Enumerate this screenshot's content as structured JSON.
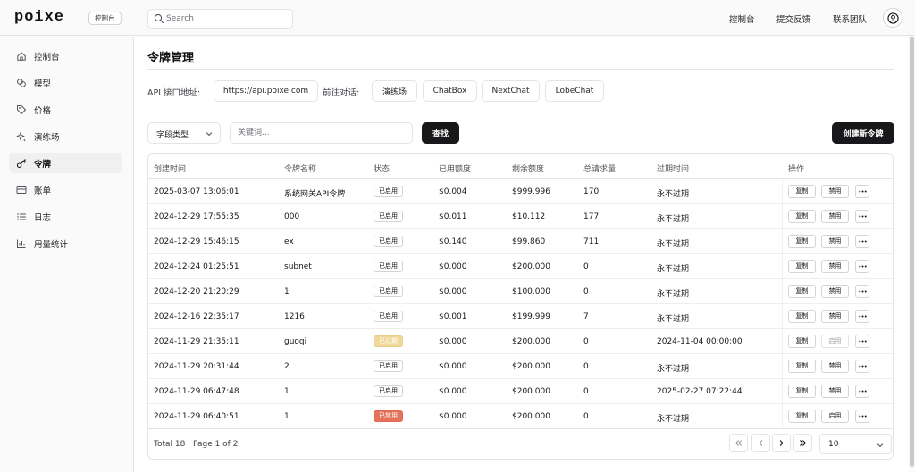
{
  "topbar": {
    "logo": "poixe",
    "console_badge": "控制台",
    "search_placeholder": "Search",
    "links": [
      "控制台",
      "提交反馈",
      "联系团队"
    ]
  },
  "sidebar": {
    "items": [
      {
        "label": "控制台",
        "icon": "home-icon",
        "active": false
      },
      {
        "label": "模型",
        "icon": "models-icon",
        "active": false
      },
      {
        "label": "价格",
        "icon": "tag-icon",
        "active": false
      },
      {
        "label": "演练场",
        "icon": "sparkle-icon",
        "active": false
      },
      {
        "label": "令牌",
        "icon": "key-icon",
        "active": true
      },
      {
        "label": "账单",
        "icon": "credit-card-icon",
        "active": false
      },
      {
        "label": "日志",
        "icon": "list-icon",
        "active": false
      },
      {
        "label": "用量统计",
        "icon": "bar-chart-icon",
        "active": false
      }
    ]
  },
  "main": {
    "title": "令牌管理",
    "api_label": "API 接口地址:",
    "api_url": "https://api.poixe.com",
    "goto_label": "前往对话:",
    "goto_buttons": [
      "演练场",
      "ChatBox",
      "NextChat",
      "LobeChat"
    ],
    "filter": {
      "type_select": "字段类型",
      "keyword_placeholder": "关键词...",
      "search_button": "查找",
      "create_button": "创建新令牌"
    }
  },
  "table": {
    "columns": [
      "创建时间",
      "令牌名称",
      "状态",
      "已用额度",
      "剩余额度",
      "总请求量",
      "过期时间",
      "操作"
    ],
    "rows": [
      {
        "created": "2025-03-07 13:06:01",
        "name": "系统网关API令牌",
        "status": "已启用",
        "status_type": "enabled",
        "used": "$0.004",
        "remaining": "$999.996",
        "requests": "170",
        "expires": "永不过期",
        "action_copy": "复制",
        "action_toggle": "禁用",
        "toggle_muted": false
      },
      {
        "created": "2024-12-29 17:55:35",
        "name": "000",
        "status": "已启用",
        "status_type": "enabled",
        "used": "$0.011",
        "remaining": "$10.112",
        "requests": "177",
        "expires": "永不过期",
        "action_copy": "复制",
        "action_toggle": "禁用",
        "toggle_muted": false
      },
      {
        "created": "2024-12-29 15:46:15",
        "name": "ex",
        "status": "已启用",
        "status_type": "enabled",
        "used": "$0.140",
        "remaining": "$99.860",
        "requests": "711",
        "expires": "永不过期",
        "action_copy": "复制",
        "action_toggle": "禁用",
        "toggle_muted": false
      },
      {
        "created": "2024-12-24 01:25:51",
        "name": "subnet",
        "status": "已启用",
        "status_type": "enabled",
        "used": "$0.000",
        "remaining": "$200.000",
        "requests": "0",
        "expires": "永不过期",
        "action_copy": "复制",
        "action_toggle": "禁用",
        "toggle_muted": false
      },
      {
        "created": "2024-12-20 21:20:29",
        "name": "1",
        "status": "已启用",
        "status_type": "enabled",
        "used": "$0.000",
        "remaining": "$100.000",
        "requests": "0",
        "expires": "永不过期",
        "action_copy": "复制",
        "action_toggle": "禁用",
        "toggle_muted": false
      },
      {
        "created": "2024-12-16 22:35:17",
        "name": "1216",
        "status": "已启用",
        "status_type": "enabled",
        "used": "$0.001",
        "remaining": "$199.999",
        "requests": "7",
        "expires": "永不过期",
        "action_copy": "复制",
        "action_toggle": "禁用",
        "toggle_muted": false
      },
      {
        "created": "2024-11-29 21:35:11",
        "name": "guoqi",
        "status": "已过期",
        "status_type": "expired",
        "used": "$0.000",
        "remaining": "$200.000",
        "requests": "0",
        "expires": "2024-11-04 00:00:00",
        "action_copy": "复制",
        "action_toggle": "启用",
        "toggle_muted": true
      },
      {
        "created": "2024-11-29 20:31:44",
        "name": "2",
        "status": "已启用",
        "status_type": "enabled",
        "used": "$0.000",
        "remaining": "$200.000",
        "requests": "0",
        "expires": "永不过期",
        "action_copy": "复制",
        "action_toggle": "禁用",
        "toggle_muted": false
      },
      {
        "created": "2024-11-29 06:47:48",
        "name": "1",
        "status": "已启用",
        "status_type": "enabled",
        "used": "$0.000",
        "remaining": "$200.000",
        "requests": "0",
        "expires": "2025-02-27 07:22:44",
        "action_copy": "复制",
        "action_toggle": "禁用",
        "toggle_muted": false
      },
      {
        "created": "2024-11-29 06:40:51",
        "name": "1",
        "status": "已禁用",
        "status_type": "disabled",
        "used": "$0.000",
        "remaining": "$200.000",
        "requests": "0",
        "expires": "永不过期",
        "action_copy": "复制",
        "action_toggle": "启用",
        "toggle_muted": false
      }
    ],
    "footer": {
      "total": "Total 18",
      "page": "Page 1 of 2",
      "page_size": "10"
    }
  },
  "colors": {
    "primary_dark": "#18181b",
    "badge_expired": "#f0d89a",
    "badge_disabled": "#e5735c",
    "border": "#e4e4e7"
  }
}
